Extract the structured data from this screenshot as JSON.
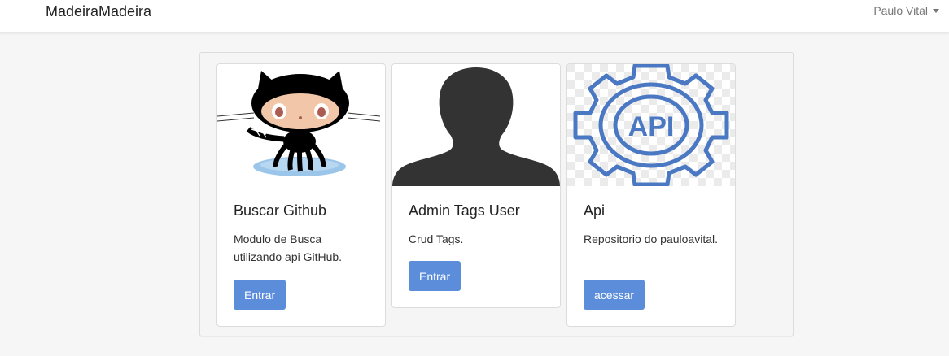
{
  "navbar": {
    "brand": "MadeiraMadeira",
    "user_name": "Paulo Vital"
  },
  "cards": [
    {
      "title": "Buscar Github",
      "text": "Modulo de Busca utilizando api GitHub.",
      "button_label": "Entrar",
      "image_icon": "github-octocat-icon"
    },
    {
      "title": "Admin Tags User",
      "text": "Crud Tags.",
      "button_label": "Entrar",
      "image_icon": "user-silhouette-icon"
    },
    {
      "title": "Api",
      "text": "Repositorio do pauloavital.",
      "button_label": "acessar",
      "image_icon": "api-gear-icon",
      "image_text": "API"
    }
  ],
  "colors": {
    "button": "#5b8ddb",
    "api_icon": "#4a78c2"
  }
}
